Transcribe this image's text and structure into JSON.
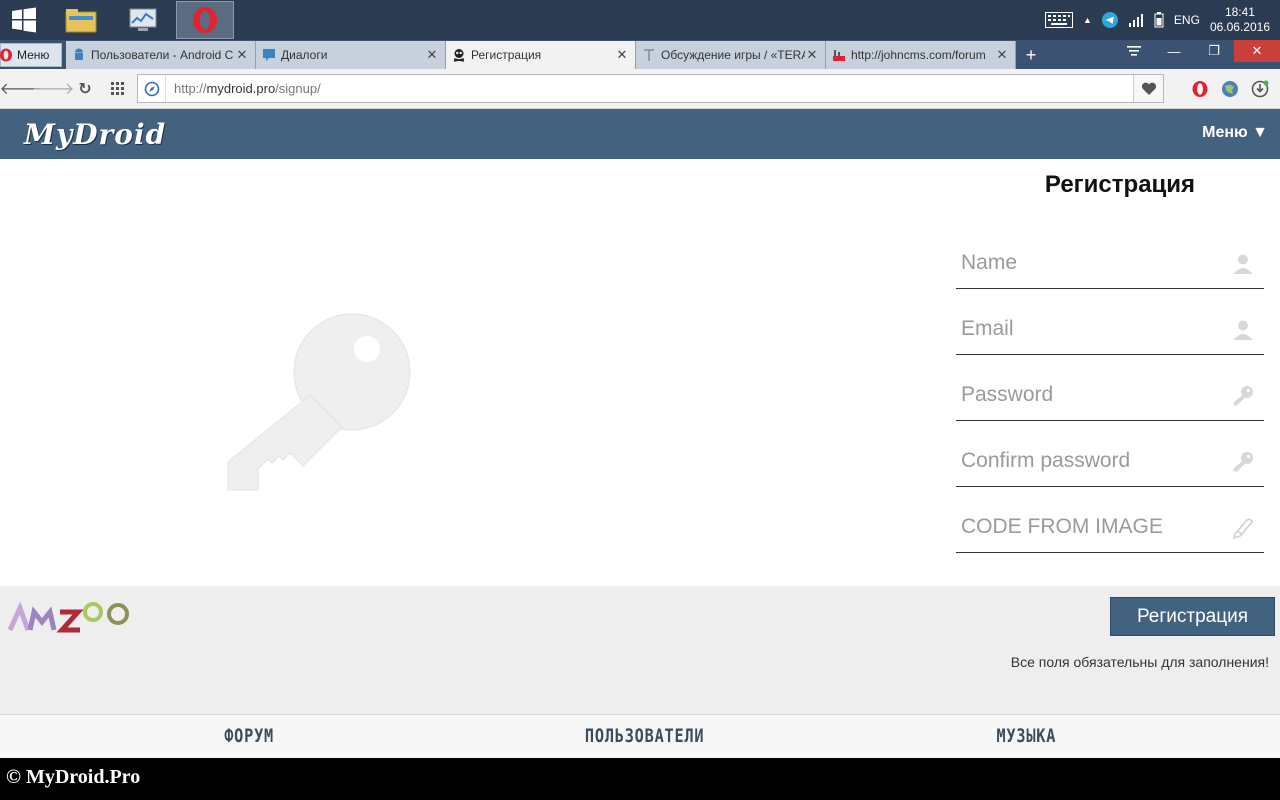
{
  "taskbar": {
    "apps": [
      "explorer",
      "monitor",
      "opera"
    ],
    "tray": {
      "language": "ENG",
      "time": "18:41",
      "date": "06.06.2016"
    }
  },
  "browser": {
    "menu_label": "Меню",
    "tabs": [
      {
        "title": "Пользователи - Android C",
        "icon": "android-icon",
        "active": false
      },
      {
        "title": "Диалоги",
        "icon": "chat-icon",
        "active": false
      },
      {
        "title": "Регистрация",
        "icon": "skull-icon",
        "active": true
      },
      {
        "title": "Обсуждение игры / «TERA",
        "icon": "tera-icon",
        "active": false
      },
      {
        "title": "http://johncms.com/forum",
        "icon": "cms-icon",
        "active": false
      }
    ],
    "url": {
      "prefix": "http://",
      "host": "mydroid.pro",
      "path": "/signup/"
    }
  },
  "site": {
    "logo": "MyDroid",
    "menu_label": "Меню ▼",
    "colors": {
      "header": "#42627f",
      "button": "#42627f"
    }
  },
  "form": {
    "title": "Регистрация",
    "fields": [
      {
        "placeholder": "Name",
        "icon": "user-icon"
      },
      {
        "placeholder": "Email",
        "icon": "user-icon"
      },
      {
        "placeholder": "Password",
        "icon": "key-icon"
      },
      {
        "placeholder": "Confirm password",
        "icon": "key-icon"
      },
      {
        "placeholder": "CODE FROM IMAGE",
        "icon": "pencil-icon"
      }
    ],
    "submit_label": "Регистрация",
    "note": "Все поля обязательны для заполнения!"
  },
  "footer": {
    "links": [
      "ФОРУМ",
      "ПОЛЬЗОВАТЕЛИ",
      "МУЗЫКА"
    ],
    "copyright": "© MyDroid.Pro"
  }
}
